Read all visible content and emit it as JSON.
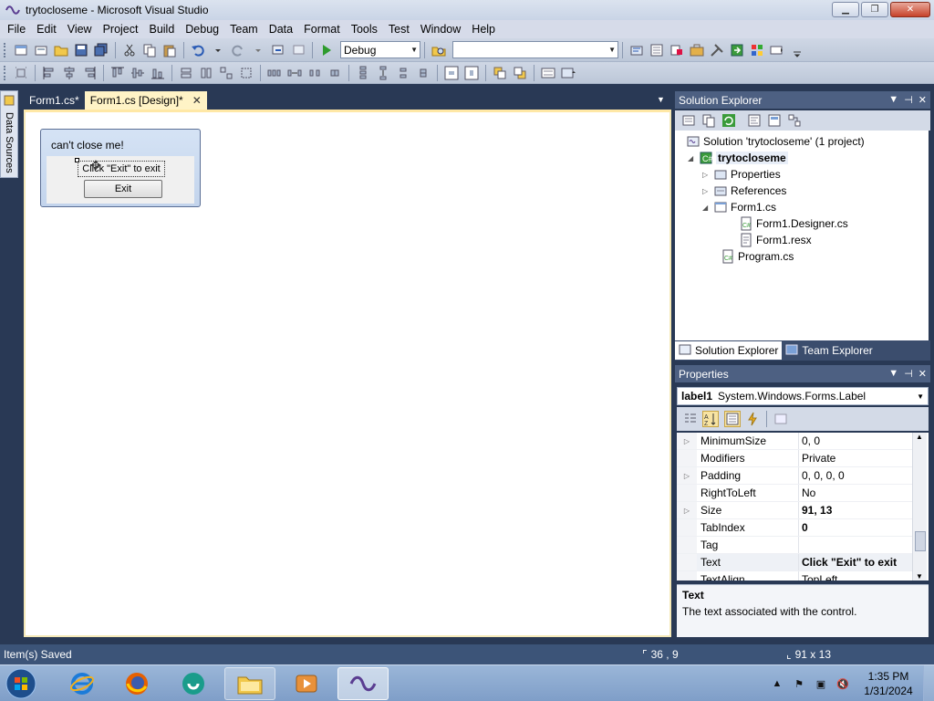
{
  "window": {
    "title": "trytocloseme - Microsoft Visual Studio"
  },
  "menu": [
    "File",
    "Edit",
    "View",
    "Project",
    "Build",
    "Debug",
    "Team",
    "Data",
    "Format",
    "Tools",
    "Test",
    "Window",
    "Help"
  ],
  "toolbar": {
    "config_value": "Debug",
    "platform_value": ""
  },
  "side_tab": {
    "label": "Data Sources"
  },
  "doc_tabs": [
    {
      "label": "Form1.cs*"
    },
    {
      "label": "Form1.cs [Design]*"
    }
  ],
  "designer": {
    "form_title": "can't close me!",
    "label_text": "Click \"Exit\" to exit",
    "button_text": "Exit"
  },
  "solution_explorer": {
    "title": "Solution Explorer",
    "tree": {
      "solution": "Solution 'trytocloseme' (1 project)",
      "project": "trytocloseme",
      "properties": "Properties",
      "references": "References",
      "form_cs": "Form1.cs",
      "designer_cs": "Form1.Designer.cs",
      "resx": "Form1.resx",
      "program": "Program.cs"
    },
    "tabs": [
      "Solution Explorer",
      "Team Explorer"
    ]
  },
  "properties": {
    "title": "Properties",
    "object_name": "label1",
    "object_type": "System.Windows.Forms.Label",
    "rows": [
      {
        "name": "MinimumSize",
        "value": "0, 0"
      },
      {
        "name": "Modifiers",
        "value": "Private"
      },
      {
        "name": "Padding",
        "value": "0, 0, 0, 0"
      },
      {
        "name": "RightToLeft",
        "value": "No"
      },
      {
        "name": "Size",
        "value": "91, 13"
      },
      {
        "name": "TabIndex",
        "value": "0"
      },
      {
        "name": "Tag",
        "value": ""
      },
      {
        "name": "Text",
        "value": "Click \"Exit\" to exit"
      },
      {
        "name": "TextAlign",
        "value": "TopLeft"
      }
    ],
    "desc_title": "Text",
    "desc_text": "The text associated with the control."
  },
  "status": {
    "message": "Item(s) Saved",
    "position": "36 , 9",
    "size": "91 x 13"
  },
  "taskbar": {
    "time": "1:35 PM",
    "date": "1/31/2024"
  },
  "colors": {
    "titlebar": "#c9d4e6",
    "chrome": "#293955",
    "panel_header": "#4d6082",
    "active_tab": "#fff3c6",
    "statusbar": "#3c5478"
  }
}
